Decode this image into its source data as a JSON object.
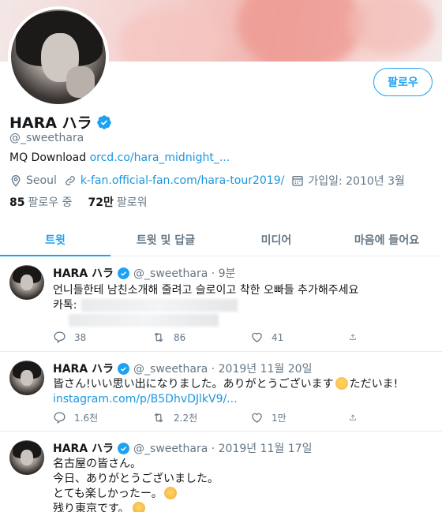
{
  "profile": {
    "display_name": "HARA ハラ",
    "handle": "@_sweethara",
    "follow_label": "팔로우",
    "bio_text": "MQ Download ",
    "bio_link": "orcd.co/hara_midnight_...",
    "location": "Seoul",
    "website": "k-fan.official-fan.com/hara-tour2019/",
    "joined": "가입일: 2010년 3월",
    "following_count": "85",
    "following_label": "팔로우 중",
    "followers_count": "72만",
    "followers_label": "팔로워"
  },
  "tabs": [
    {
      "label": "트윗"
    },
    {
      "label": "트윗 및 답글"
    },
    {
      "label": "미디어"
    },
    {
      "label": "마음에 들어요"
    }
  ],
  "tweets": [
    {
      "name": "HARA ハラ",
      "handle_time": "@_sweethara · 9분",
      "line1": "언니들한테 남친소개해 줄려고 슬로이고 착한 오빠들 추가해주세요",
      "line2": "카톡:",
      "replies": "38",
      "retweets": "86",
      "likes": "41"
    },
    {
      "name": "HARA ハラ",
      "handle_time": "@_sweethara · 2019년 11월 20일",
      "line1a": "皆さん!いい思い出になりました。ありがとうございます",
      "line1b": "ただいま!",
      "link": "instagram.com/p/B5DhvDJlkV9/...",
      "replies": "1.6천",
      "retweets": "2.2천",
      "likes": "1만"
    },
    {
      "name": "HARA ハラ",
      "handle_time": "@_sweethara · 2019년 11월 17일",
      "line1": "名古屋の皆さん。",
      "line2": "今日、ありがとうございました。",
      "line3": "とても楽しかったー。",
      "line4": "残り東京です。"
    }
  ],
  "colors": {
    "accent": "#1da1f2",
    "link": "#1b95e0",
    "muted": "#657786",
    "text": "#14171a"
  },
  "icons": [
    "verified-badge-icon",
    "location-icon",
    "link-icon",
    "calendar-icon",
    "reply-icon",
    "retweet-icon",
    "like-icon",
    "share-icon",
    "smile-emoji-icon",
    "heart-face-emoji-icon",
    "crying-emoji-icon"
  ]
}
